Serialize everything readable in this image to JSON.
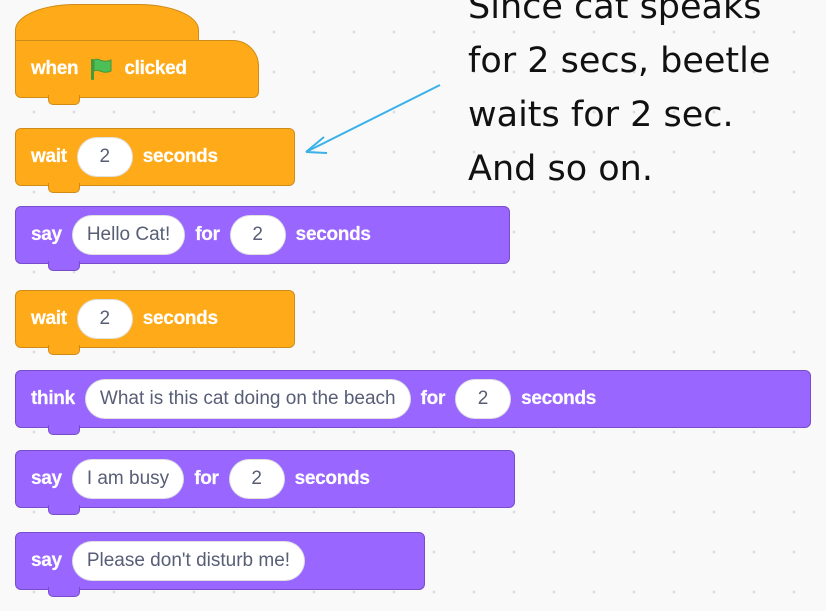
{
  "colors": {
    "control": "#ffab19",
    "looks": "#9966ff",
    "flag": "#4cbf56",
    "annotation_arrow": "#3bb1e8"
  },
  "blocks": {
    "hat": {
      "text1": "when",
      "icon": "green-flag-icon",
      "text2": "clicked"
    },
    "wait1": {
      "label": "wait",
      "value": "2",
      "unit": "seconds"
    },
    "say1": {
      "label": "say",
      "message": "Hello Cat!",
      "for": "for",
      "value": "2",
      "unit": "seconds"
    },
    "wait2": {
      "label": "wait",
      "value": "2",
      "unit": "seconds"
    },
    "think1": {
      "label": "think",
      "message": "What is this cat doing on the beach",
      "for": "for",
      "value": "2",
      "unit": "seconds"
    },
    "say2": {
      "label": "say",
      "message": "I am busy",
      "for": "for",
      "value": "2",
      "unit": "seconds"
    },
    "say3": {
      "label": "say",
      "message": "Please don't disturb me!"
    }
  },
  "annotation": {
    "lines": [
      "Since cat speaks",
      "for 2 secs, beetle",
      "waits for 2 sec.",
      "And so on."
    ]
  }
}
